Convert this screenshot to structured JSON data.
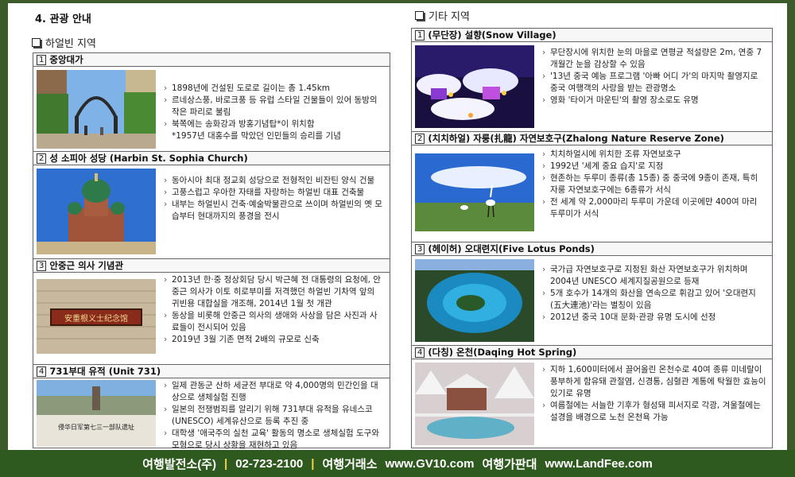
{
  "section_title": "4. 관광 안내",
  "left_region": "하얼빈 지역",
  "right_region": "기타 지역",
  "left_items": [
    {
      "num": "1",
      "title": "중앙대가",
      "bullets": [
        "1898년에 건설된 도로로 길이는 총 1.45km",
        "르네상스풍, 바로크풍 등 유럽 스타일 건물들이 있어 동방의 작은 파리로 불림",
        "북쪽에는 송화강과 방홍기념탑*이 위치함"
      ],
      "note": "*1957년 대홍수를 막았던 인민들의 승리를 기념"
    },
    {
      "num": "2",
      "title": "성 소피아 성당 (Harbin St. Sophia Church)",
      "bullets": [
        "동아시아 최대 정교회 성당으로 전형적인 비잔틴 양식 건물",
        "고풍스럽고 우아한 자태를 자랑하는 하얼빈 대표 건축물",
        "내부는 하얼빈시 건축·예술박물관으로 쓰이며 하얼빈의 옛 모습부터 현대까지의 풍경을 전시"
      ]
    },
    {
      "num": "3",
      "title": "안중근 의사 기념관",
      "sign_text": "安重根义士纪念馆",
      "bullets": [
        "2013년 한·중 정상회담 당시 박근혜 전 대통령의 요청에, 안중근 의사가 이토 히로부미를 저격했던 하얼빈 기차역 앞의 귀빈용 대합실을 개조해, 2014년 1월 첫 개관",
        "동상을 비롯해 안중근 의사의 생애와 사상을 담은 사진과 사료들이 전시되어 있음",
        "2019년 3월 기존 면적 2배의 규모로 신축"
      ]
    },
    {
      "num": "4",
      "title": "731부대 유적 (Unit 731)",
      "sign_text": "侵华日军第七三一部队遗址",
      "bullets": [
        "일제 관동군 산하 세균전 부대로 약 4,000명의 민간인을 대상으로 생체실험 진행",
        "일본의 전쟁범죄를 알리기 위해 731부대 유적을 유네스코(UNESCO) 세계유산으로 등록 추진 중",
        "대학생 '애국주의 실천 교육' 활동의 명소로 생체실험 도구와 모형으로 당시 상황을 재현하고 있음"
      ]
    }
  ],
  "right_items": [
    {
      "num": "1",
      "title": "(무단장) 설향(Snow Village)",
      "bullets": [
        "무단장시에 위치한 눈의 마을로 연평균 적설량은 2m, 연중 7개월간 눈을 감상할 수 있음",
        "'13년 중국 예능 프로그램 '아빠 어디 가'의 마지막 촬영지로 중국 여행객의 사랑을 받는 관광명소",
        "영화 '타이거 마운틴'의 촬영 장소로도 유명"
      ]
    },
    {
      "num": "2",
      "title": "(치치하얼) 자룽(扎龍) 자연보호구(Zhalong Nature Reserve Zone)",
      "bullets": [
        "치치하얼시에 위치한 조류 자연보호구",
        "1992년 '세계 중요 습지'로 지정",
        "현존하는 두루미 종류(총 15종) 중 중국에 9종이 존재, 특히 자룽 자연보호구에는 6종류가 서식",
        "전 세계 약 2,000마리 두루미 가운데 이곳에만 400여 마리 두루미가 서식"
      ]
    },
    {
      "num": "3",
      "title": "(헤이허) 오대련지(Five Lotus Ponds)",
      "bullets": [
        "국가급 자연보호구로 지정된 화산 자연보호구가 위치하며 2004년 UNESCO 세계지질공원으로 등재",
        "5개 호수가 14개의 화산을 연속으로 휘감고 있어 '오대련지(五大連池)'라는 별칭이 있음",
        "2012년 중국 10대 문화·관광 유명 도시에 선정"
      ]
    },
    {
      "num": "4",
      "title": "(다칭) 온천(Daqing Hot Spring)",
      "bullets": [
        "지하 1,600미터에서 끌어올린 온천수로 40여 종류 미네랄이 풍부하게 함유돼 관절염, 신경통, 심혈관 계통에 탁월한 효능이 있기로 유명",
        "여름철에는 서늘한 기후가 형성돼 피서지로 각광, 겨울철에는 설경을 배경으로 노천 온천욕 가능"
      ]
    }
  ],
  "footer": {
    "company": "여행발전소(주)",
    "phone": "02-723-2100",
    "exchange_label": "여행거래소",
    "exchange_url": "www.GV10.com",
    "market_label": "여행가판대",
    "market_url": "www.LandFee.com"
  },
  "colors": {
    "footer_bg": "#2f5a1f",
    "footer_separator": "#f3d24a"
  }
}
